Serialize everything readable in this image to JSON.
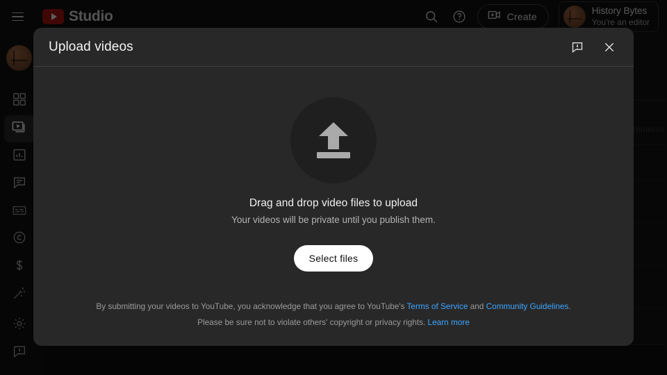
{
  "topbar": {
    "menu_icon": "hamburger-menu-icon",
    "brand": "Studio",
    "logo_icon": "youtube-logo-icon",
    "search_icon": "search-icon",
    "help_icon": "help-circle-icon",
    "create_label": "Create",
    "create_icon": "video-plus-icon",
    "account": {
      "name": "History Bytes",
      "role": "You're an editor",
      "avatar_icon": "channel-avatar"
    }
  },
  "sidebar": {
    "avatar_icon": "channel-avatar",
    "items": [
      {
        "name": "dashboard",
        "icon": "dashboard-grid-icon",
        "active": false
      },
      {
        "name": "content",
        "icon": "content-video-icon",
        "active": true
      },
      {
        "name": "analytics",
        "icon": "analytics-bar-chart-icon",
        "active": false
      },
      {
        "name": "comments",
        "icon": "comments-bubble-icon",
        "active": false
      },
      {
        "name": "subtitles",
        "icon": "subtitles-icon",
        "active": false
      },
      {
        "name": "copyright",
        "icon": "copyright-circle-icon",
        "active": false
      },
      {
        "name": "earn",
        "icon": "dollar-sign-icon",
        "active": false
      },
      {
        "name": "customization",
        "icon": "magic-wand-icon",
        "active": false
      },
      {
        "name": "settings",
        "icon": "gear-icon",
        "active": false
      },
      {
        "name": "send-feedback",
        "icon": "feedback-bubble-icon",
        "active": false
      }
    ]
  },
  "background": {
    "comments_column_header": "Comments"
  },
  "dialog": {
    "title": "Upload videos",
    "feedback_icon": "feedback-bubble-icon",
    "close_icon": "close-x-icon",
    "upload_icon": "upload-arrow-icon",
    "headline": "Drag and drop video files to upload",
    "subline": "Your videos will be private until you publish them.",
    "select_files_label": "Select files",
    "legal": {
      "line1_prefix": "By submitting your videos to YouTube, you acknowledge that you agree to YouTube's ",
      "terms_link": "Terms of Service",
      "line1_mid": " and ",
      "guidelines_link": "Community Guidelines",
      "line1_suffix": ".",
      "line2_prefix": "Please be sure not to violate others' copyright or privacy rights. ",
      "learn_more_link": "Learn more"
    }
  },
  "colors": {
    "page_background": "#0f0f0f",
    "dialog_background": "#282828",
    "accent_link": "#3ea6ff",
    "brand_red": "#8f1111",
    "primary_button": "#ffffff"
  }
}
